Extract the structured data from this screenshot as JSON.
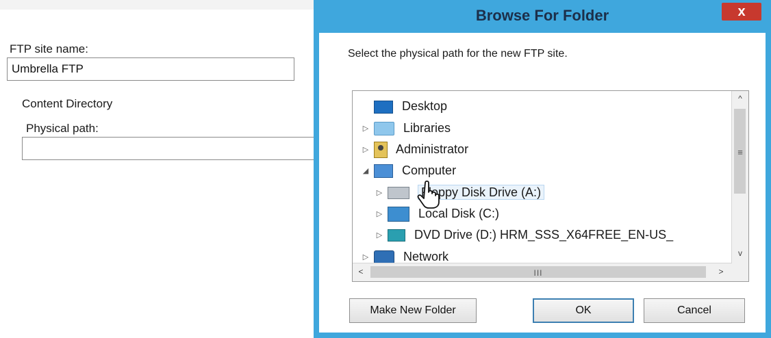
{
  "wizard": {
    "ftp_site_name_label": "FTP site name:",
    "ftp_site_name_value": "Umbrella FTP",
    "content_directory_label": "Content Directory",
    "physical_path_label": "Physical path:",
    "physical_path_value": ""
  },
  "dialog": {
    "title": "Browse For Folder",
    "close_label": "x",
    "description": "Select the physical path for the new FTP site.",
    "tree": [
      {
        "label": "Desktop",
        "icon": "desktop-icon",
        "expander": ""
      },
      {
        "label": "Libraries",
        "icon": "libraries-folder-icon",
        "expander": "▷"
      },
      {
        "label": "Administrator",
        "icon": "user-folder-icon",
        "expander": "▷"
      },
      {
        "label": "Computer",
        "icon": "computer-icon",
        "expander": "◢"
      },
      {
        "label": "Floppy Disk Drive (A:)",
        "icon": "floppy-drive-icon",
        "expander": "▷"
      },
      {
        "label": "Local Disk (C:)",
        "icon": "local-disk-icon",
        "expander": "▷"
      },
      {
        "label": "DVD Drive (D:) HRM_SSS_X64FREE_EN-US_",
        "icon": "dvd-drive-icon",
        "expander": "▷"
      },
      {
        "label": "Network",
        "icon": "network-icon",
        "expander": "▷"
      }
    ],
    "scroll": {
      "up": "^",
      "down": "v",
      "left": "<",
      "right": ">",
      "grip_v": "≡",
      "grip_h": "III"
    },
    "buttons": {
      "make_new_folder": "Make New Folder",
      "ok": "OK",
      "cancel": "Cancel"
    }
  },
  "colors": {
    "dialog_frame": "#3fa7dd",
    "close_button": "#c7392e",
    "default_button_border": "#3c7fb1"
  }
}
